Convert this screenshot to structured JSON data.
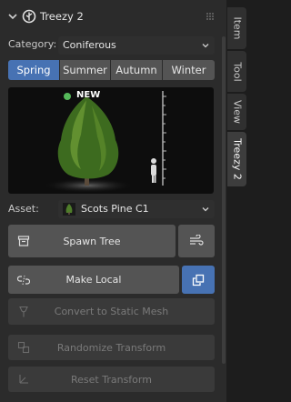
{
  "panel": {
    "title": "Treezy 2",
    "category_label": "Category:",
    "category_value": "Coniferous",
    "seasons": [
      "Spring",
      "Summer",
      "Autumn",
      "Winter"
    ],
    "active_season": "Spring",
    "preview_badge": "NEW",
    "asset_label": "Asset:",
    "asset_value": "Scots Pine C1",
    "spawn_button": "Spawn Tree",
    "make_local_button": "Make Local",
    "convert_button": "Convert to Static Mesh",
    "randomize_button": "Randomize Transform",
    "reset_button": "Reset Transform"
  },
  "tabs": [
    "Item",
    "Tool",
    "View",
    "Treezy 2"
  ],
  "active_tab": "Treezy 2",
  "colors": {
    "accent": "#4772b3",
    "panel_bg": "#2b2b2b",
    "button_bg": "#545454",
    "disabled_button_bg": "#3a3a3a",
    "badge_dot": "#55b85a"
  },
  "icons": {
    "collapse": "chevron-down-icon",
    "logo": "treezy-logo-icon",
    "grip": "drag-grip-icon",
    "spawn": "box-icon",
    "wind": "wind-icon",
    "make_local": "unlink-icon",
    "copy": "duplicate-icon",
    "convert": "mesh-convert-icon",
    "randomize": "dice-icon",
    "reset": "transform-icon"
  }
}
